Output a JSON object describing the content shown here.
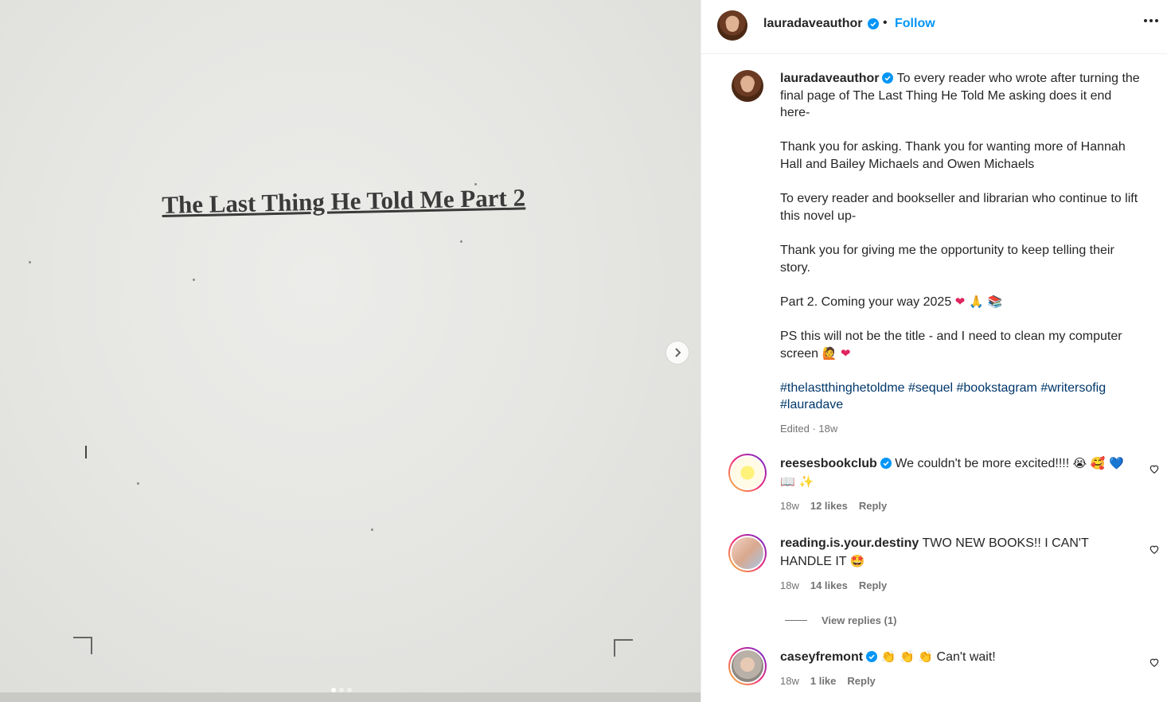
{
  "post": {
    "doc_title": "The Last Thing He Told Me Part 2",
    "carousel_dots": 3,
    "active_dot": 0
  },
  "header": {
    "username": "lauradaveauthor",
    "separator": "•",
    "follow_label": "Follow"
  },
  "caption": {
    "username": "lauradaveauthor",
    "lines": {
      "p1": "To every reader who wrote after turning the final page of The Last Thing He Told Me asking does it end here-",
      "p2": "Thank you for asking. Thank you for wanting more of Hannah Hall and Bailey Michaels and Owen Michaels",
      "p3": "To every reader and bookseller and librarian who continue to lift this novel up-",
      "p4": "Thank you for giving me the opportunity to keep telling their story.",
      "p5": "Part 2. Coming your way 2025",
      "p5_emoji": "❤ 🙏 📚",
      "p6": "PS this will not be the title - and I need to clean my computer screen",
      "p6_emoji": "🙋 ❤"
    },
    "hashtags": "#thelastthinghetoldme #sequel #bookstagram #writersofig #lauradave",
    "meta": "Edited · 18w"
  },
  "comments": [
    {
      "username": "reesesbookclub",
      "verified": true,
      "text": "We couldn't be more excited!!!!",
      "emoji": "😭 🥰 💙 📖 ✨",
      "time": "18w",
      "likes": "12 likes",
      "reply": "Reply"
    },
    {
      "username": "reading.is.your.destiny",
      "verified": false,
      "text": "TWO NEW BOOKS!! I CAN'T HANDLE IT",
      "emoji": "🤩",
      "time": "18w",
      "likes": "14 likes",
      "reply": "Reply"
    },
    {
      "username": "caseyfremont",
      "verified": true,
      "text": "Can't wait!",
      "emoji": "👏 👏 👏",
      "time": "18w",
      "likes": "1 like",
      "reply": "Reply"
    }
  ],
  "view_replies": "View replies (1)",
  "colors": {
    "link_blue": "#0095f6",
    "hashtag": "#00376b",
    "muted": "#737373",
    "verified_blue": "#0095f6"
  }
}
